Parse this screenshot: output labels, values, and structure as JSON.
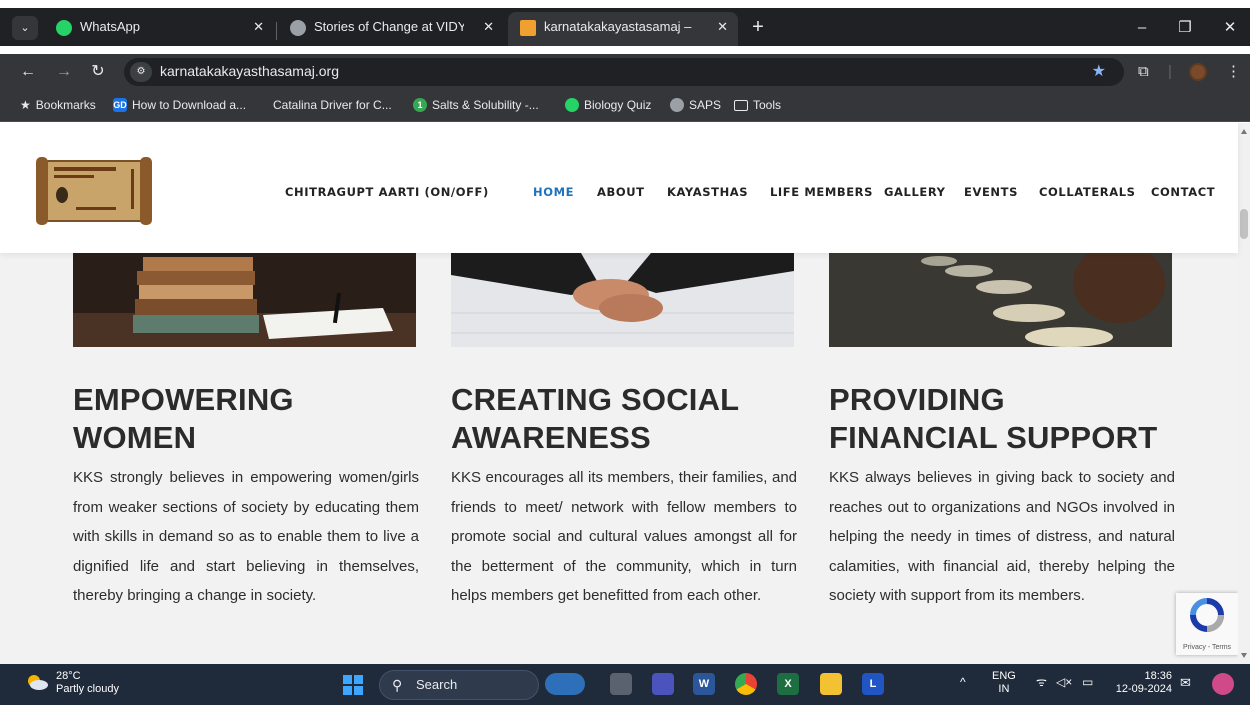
{
  "browser": {
    "tabs": [
      {
        "title": "WhatsApp",
        "active": false,
        "favicon_color": "#25d366"
      },
      {
        "title": "Stories of Change at VIDYA – Vi",
        "active": false,
        "favicon_color": "#9aa0a6"
      },
      {
        "title": "karnatakakayastasamaj – karna",
        "active": true,
        "favicon_color": "#f0a030"
      }
    ],
    "url": "karnatakakayasthasamaj.org",
    "bookmarks": [
      {
        "label": "Bookmarks",
        "icon": "star-icon"
      },
      {
        "label": "How to Download a...",
        "icon": "gd-icon",
        "badge": "GD"
      },
      {
        "label": "Catalina Driver for C...",
        "icon": "apple-icon"
      },
      {
        "label": "Salts & Solubility -...",
        "icon": "number-icon",
        "badge": "1"
      },
      {
        "label": "Biology Quiz",
        "icon": "whatsapp-icon"
      },
      {
        "label": "SAPS",
        "icon": "globe-icon"
      },
      {
        "label": "Tools",
        "icon": "folder-icon"
      }
    ]
  },
  "site": {
    "nav": [
      {
        "label": "CHITRAGUPT AARTI (ON/OFF)",
        "active": false
      },
      {
        "label": "HOME",
        "active": true
      },
      {
        "label": "ABOUT",
        "active": false
      },
      {
        "label": "KAYASTHAS",
        "active": false
      },
      {
        "label": "LIFE MEMBERS",
        "active": false
      },
      {
        "label": "GALLERY",
        "active": false
      },
      {
        "label": "EVENTS",
        "active": false
      },
      {
        "label": "COLLATERALS",
        "active": false
      },
      {
        "label": "CONTACT",
        "active": false
      }
    ],
    "columns": [
      {
        "title": "EMPOWERING WOMEN",
        "body": "KKS strongly believes in empowering women/girls from weaker sections of society by educating them with skills in demand so as to enable them to live a dignified life and start believing in themselves, thereby bringing a change in society.",
        "image": "books-and-notebook"
      },
      {
        "title": "CREATING SOCIAL AWARENESS",
        "body": "KKS encourages all its members, their families, and friends to meet/ network with fellow members to promote social and cultural values amongst all for the betterment of the community, which in turn helps members get benefitted from each other.",
        "image": "handshake"
      },
      {
        "title": "PROVIDING FINANCIAL SUPPORT",
        "body": "KKS always believes in giving back to society and reaches out to organizations and NGOs involved in helping the needy in times of distress, and natural calamities, with financial aid, thereby helping the society with support from its members.",
        "image": "food-plates"
      }
    ],
    "recaptcha": "Privacy - Terms"
  },
  "taskbar": {
    "weather": {
      "temp": "28°C",
      "desc": "Partly cloudy"
    },
    "search_placeholder": "Search",
    "lang": {
      "line1": "ENG",
      "line2": "IN"
    },
    "time": "18:36",
    "date": "12-09-2024"
  },
  "colors": {
    "accent": "#1e73be",
    "heading": "#2b2b2b",
    "chrome_dark": "#202124",
    "taskbar": "#1f2a3a"
  }
}
